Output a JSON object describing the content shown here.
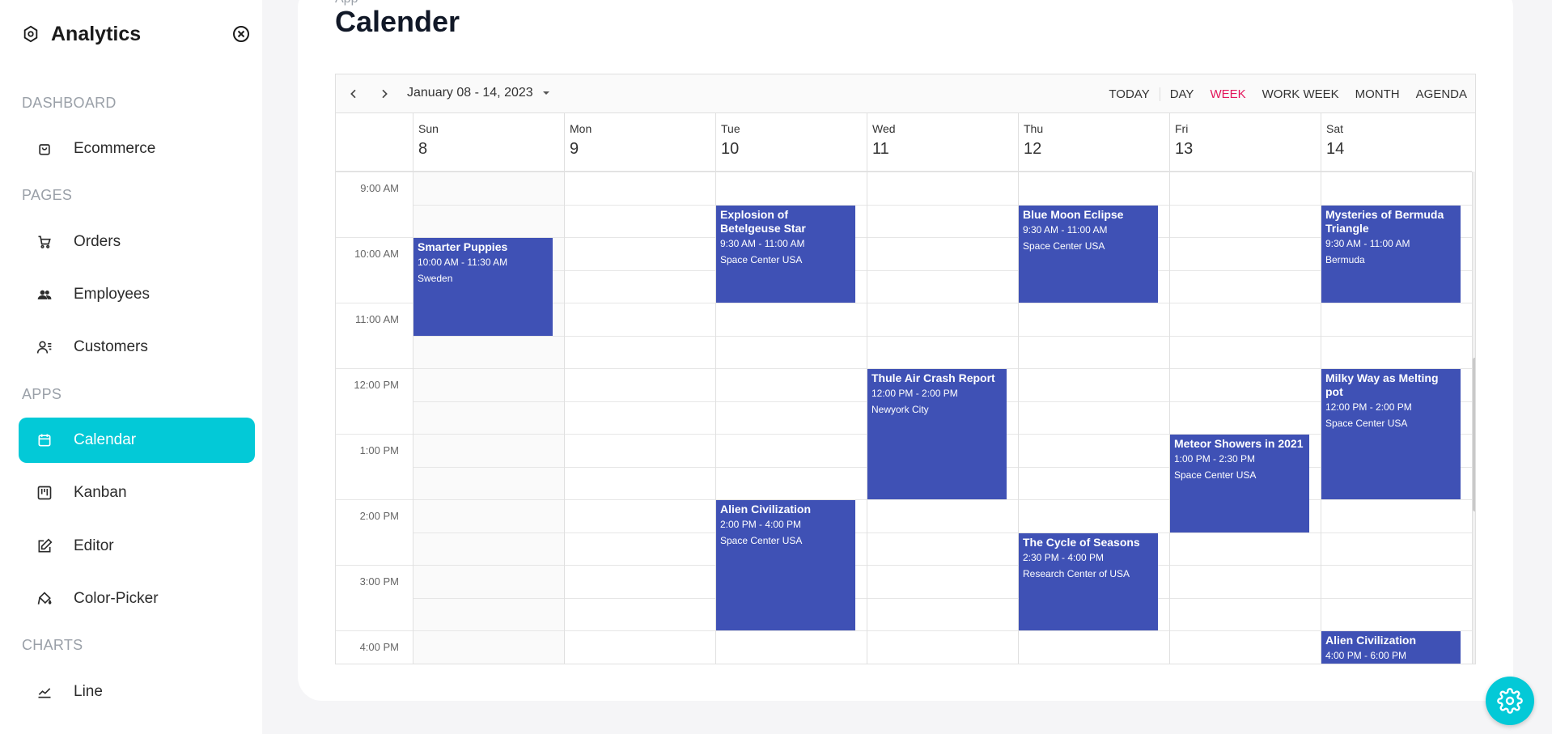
{
  "brand": {
    "name": "Analytics"
  },
  "sidebar": {
    "sections": [
      {
        "title": "DASHBOARD"
      },
      {
        "title": "PAGES"
      },
      {
        "title": "APPS"
      },
      {
        "title": "CHARTS"
      }
    ],
    "items": [
      {
        "label": "Ecommerce",
        "icon": "shopping-bag-icon"
      },
      {
        "label": "Orders",
        "icon": "cart-icon"
      },
      {
        "label": "Employees",
        "icon": "employees-icon"
      },
      {
        "label": "Customers",
        "icon": "customers-icon"
      },
      {
        "label": "Calendar",
        "icon": "calendar-icon",
        "active": true
      },
      {
        "label": "Kanban",
        "icon": "kanban-icon"
      },
      {
        "label": "Editor",
        "icon": "edit-icon"
      },
      {
        "label": "Color-Picker",
        "icon": "paint-bucket-icon"
      },
      {
        "label": "Line",
        "icon": "line-chart-icon"
      }
    ]
  },
  "page": {
    "crumb": "App",
    "title": "Calender"
  },
  "scheduler": {
    "date_range": "January 08 - 14, 2023",
    "views": {
      "today": "TODAY",
      "day": "DAY",
      "week": "WEEK",
      "work_week": "WORK WEEK",
      "month": "MONTH",
      "agenda": "AGENDA",
      "active": "WEEK"
    },
    "days": [
      {
        "name": "Sun",
        "date": "8"
      },
      {
        "name": "Mon",
        "date": "9"
      },
      {
        "name": "Tue",
        "date": "10"
      },
      {
        "name": "Wed",
        "date": "11"
      },
      {
        "name": "Thu",
        "date": "12"
      },
      {
        "name": "Fri",
        "date": "13"
      },
      {
        "name": "Sat",
        "date": "14"
      }
    ],
    "times": [
      "9:00 AM",
      "10:00 AM",
      "11:00 AM",
      "12:00 PM",
      "1:00 PM",
      "2:00 PM",
      "3:00 PM",
      "4:00 PM"
    ],
    "events": [
      {
        "title": "Smarter Puppies",
        "time": "10:00 AM - 11:30 AM",
        "location": "Sweden",
        "day": 0,
        "start": 10.0,
        "end": 11.5
      },
      {
        "title": "Explosion of Betelgeuse Star",
        "time": "9:30 AM - 11:00 AM",
        "location": "Space Center USA",
        "day": 2,
        "start": 9.5,
        "end": 11.0
      },
      {
        "title": "Blue Moon Eclipse",
        "time": "9:30 AM - 11:00 AM",
        "location": "Space Center USA",
        "day": 4,
        "start": 9.5,
        "end": 11.0
      },
      {
        "title": "Mysteries of Bermuda Triangle",
        "time": "9:30 AM - 11:00 AM",
        "location": "Bermuda",
        "day": 6,
        "start": 9.5,
        "end": 11.0
      },
      {
        "title": "Thule Air Crash Report",
        "time": "12:00 PM - 2:00 PM",
        "location": "Newyork City",
        "day": 3,
        "start": 12.0,
        "end": 14.0
      },
      {
        "title": "Milky Way as Melting pot",
        "time": "12:00 PM - 2:00 PM",
        "location": "Space Center USA",
        "day": 6,
        "start": 12.0,
        "end": 14.0
      },
      {
        "title": "Meteor Showers in 2021",
        "time": "1:00 PM - 2:30 PM",
        "location": "Space Center USA",
        "day": 5,
        "start": 13.0,
        "end": 14.5
      },
      {
        "title": "Alien Civilization",
        "time": "2:00 PM - 4:00 PM",
        "location": "Space Center USA",
        "day": 2,
        "start": 14.0,
        "end": 16.0
      },
      {
        "title": "The Cycle of Seasons",
        "time": "2:30 PM - 4:00 PM",
        "location": "Research Center of USA",
        "day": 4,
        "start": 14.5,
        "end": 16.0
      },
      {
        "title": "Alien Civilization",
        "time": "4:00 PM - 6:00 PM",
        "location": "",
        "day": 6,
        "start": 16.0,
        "end": 18.0
      }
    ]
  },
  "colors": {
    "accent": "#03c9d7",
    "event": "#3f51b5",
    "active_view": "#e3165b"
  }
}
